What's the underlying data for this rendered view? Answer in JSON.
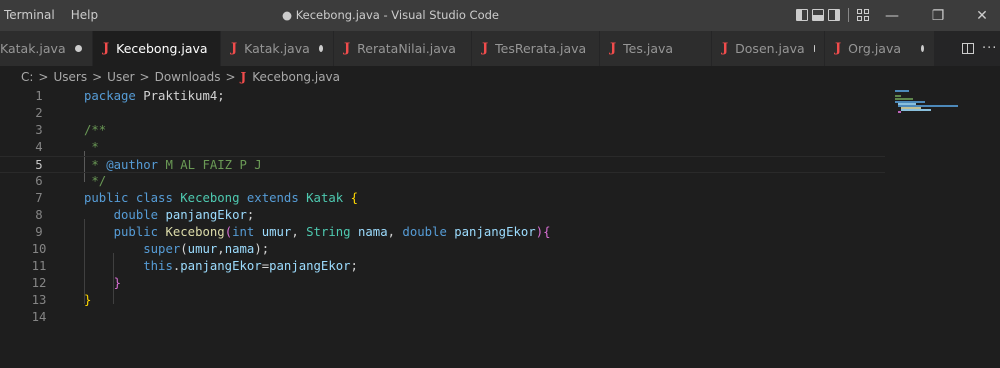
{
  "menu": [
    "Terminal",
    "Help"
  ],
  "window_title": "● Kecebong.java - Visual Studio Code",
  "window_controls": {
    "minimize": "—",
    "restore": "❐",
    "close": "✕"
  },
  "tabs": [
    {
      "label": "Katak.java",
      "icon": "",
      "modified": true,
      "active": false
    },
    {
      "label": "Kecebong.java",
      "icon": "J",
      "modified": true,
      "active": true
    },
    {
      "label": "Katak.java",
      "icon": "J",
      "modified": true,
      "active": false
    },
    {
      "label": "RerataNilai.java",
      "icon": "J",
      "modified": true,
      "active": false
    },
    {
      "label": "TesRerata.java",
      "icon": "J",
      "modified": true,
      "active": false
    },
    {
      "label": "Tes.java",
      "icon": "J",
      "modified": true,
      "active": false
    },
    {
      "label": "Dosen.java",
      "icon": "J",
      "modified": true,
      "active": false
    },
    {
      "label": "Org.java",
      "icon": "J",
      "modified": true,
      "active": false
    }
  ],
  "tab_actions": {
    "more": "···"
  },
  "breadcrumb": {
    "parts": [
      "C:",
      "Users",
      "User",
      "Downloads"
    ],
    "separator": ">",
    "file_icon": "J",
    "file": "Kecebong.java"
  },
  "editor": {
    "current_line": 5,
    "line_numbers": [
      "1",
      "2",
      "3",
      "4",
      "5",
      "6",
      "7",
      "8",
      "9",
      "10",
      "11",
      "12",
      "13",
      "14"
    ]
  },
  "colors": {
    "keyword": "#569cd6",
    "comment": "#6a9955",
    "type": "#4ec9b0",
    "variable": "#9cdcfe",
    "function": "#dcdcaa",
    "java_icon": "#f14c4c",
    "background": "#1e1e1e",
    "titlebar": "#3c3c3c"
  },
  "icons": {
    "layout_toggles": [
      "sidebar-left-icon",
      "panel-bottom-icon",
      "sidebar-right-icon",
      "customize-layout-icon"
    ],
    "split_editor": "split-editor-icon"
  }
}
